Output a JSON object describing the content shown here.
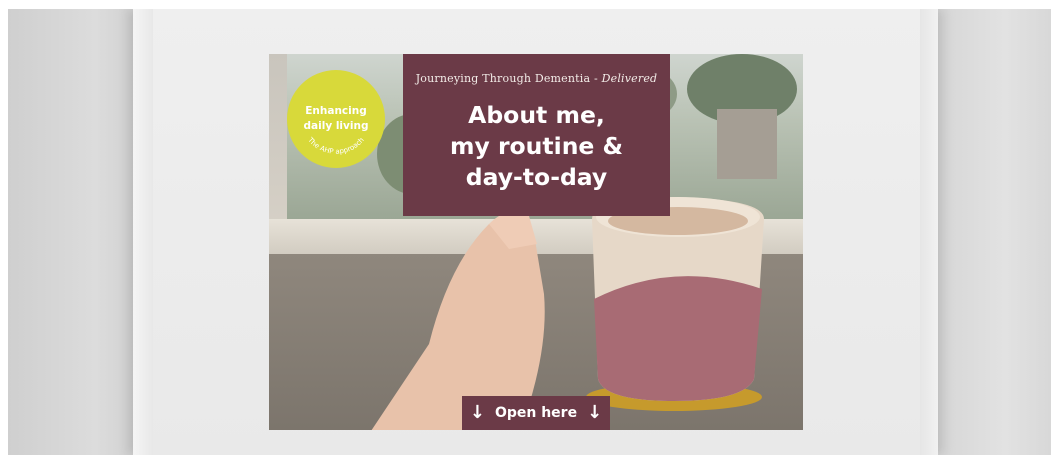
{
  "badge": {
    "line1": "Enhancing",
    "line2": "daily living",
    "arc_text": "The AHP approach",
    "color": "#d8d93a"
  },
  "panel": {
    "series_prefix": "Journeying Through Dementia - ",
    "series_suffix": "Delivered",
    "heading_line1": "About me,",
    "heading_line2": "my routine &",
    "heading_line3": "day-to-day",
    "color": "#6b3a47"
  },
  "open_tab": {
    "label": "Open here",
    "left_icon": "arrow-down-icon",
    "right_icon": "arrow-down-icon"
  }
}
